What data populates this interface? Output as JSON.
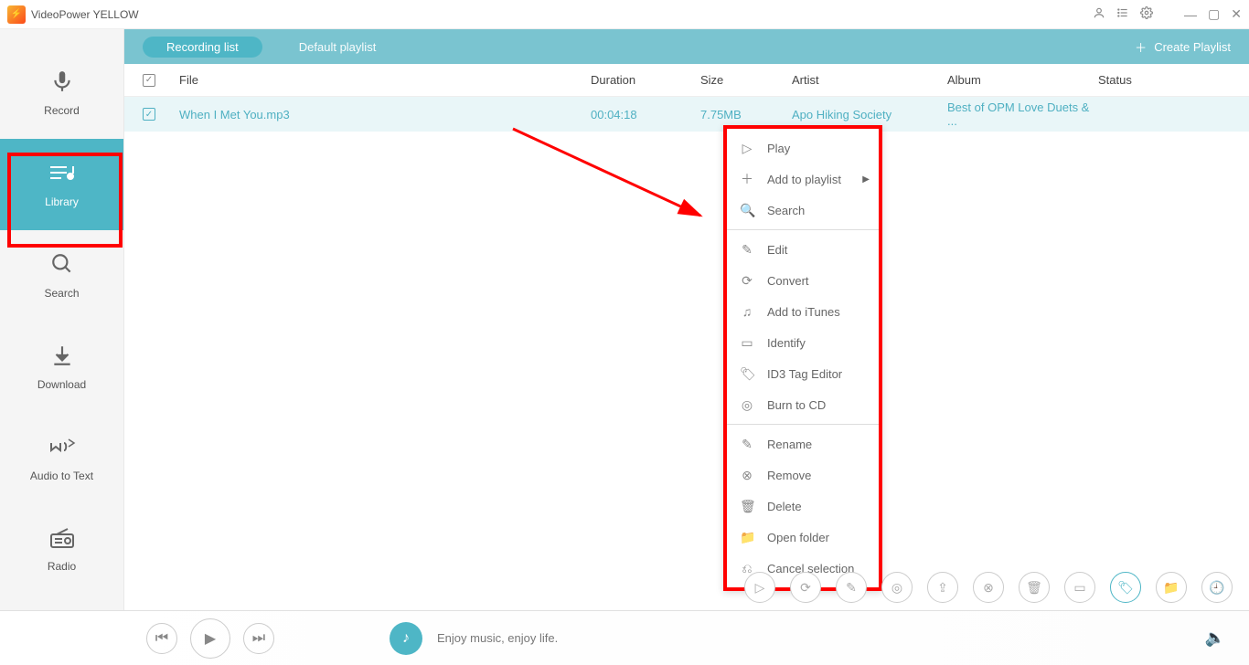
{
  "titlebar": {
    "title": "VideoPower YELLOW"
  },
  "sidebar": {
    "items": [
      {
        "label": "Record"
      },
      {
        "label": "Library"
      },
      {
        "label": "Search"
      },
      {
        "label": "Download"
      },
      {
        "label": "Audio to Text"
      },
      {
        "label": "Radio"
      }
    ]
  },
  "tabs": {
    "recording": "Recording list",
    "default": "Default playlist",
    "create": "Create Playlist"
  },
  "columns": {
    "file": "File",
    "duration": "Duration",
    "size": "Size",
    "artist": "Artist",
    "album": "Album",
    "status": "Status"
  },
  "rows": [
    {
      "file": "When I Met You.mp3",
      "duration": "00:04:18",
      "size": "7.75MB",
      "artist": "Apo Hiking Society",
      "album": "Best of OPM Love Duets & ..."
    }
  ],
  "context_menu": {
    "play": "Play",
    "add_playlist": "Add to playlist",
    "search": "Search",
    "edit": "Edit",
    "convert": "Convert",
    "add_itunes": "Add to iTunes",
    "identify": "Identify",
    "id3": "ID3 Tag Editor",
    "burn": "Burn to CD",
    "rename": "Rename",
    "remove": "Remove",
    "delete": "Delete",
    "open_folder": "Open folder",
    "cancel": "Cancel selection"
  },
  "player": {
    "status_text": "Enjoy music, enjoy life."
  }
}
